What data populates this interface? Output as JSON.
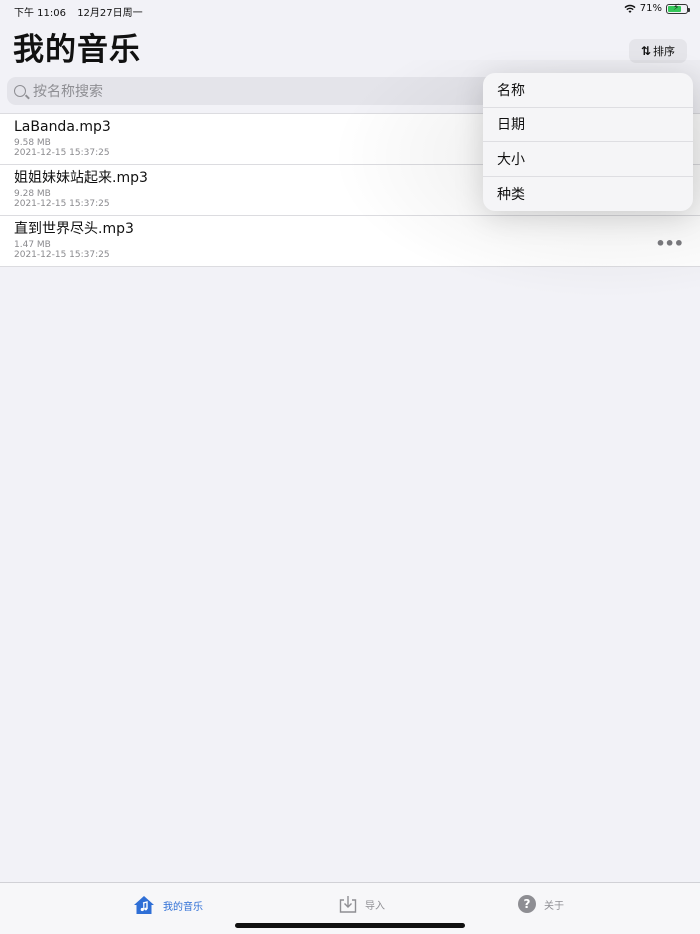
{
  "status_bar": {
    "time": "下午 11:06",
    "date": "12月27日周一",
    "battery": "71%",
    "battery_level": 0.71
  },
  "header": {
    "title": "我的音乐",
    "sort_label": "排序",
    "sort_icon": "sort-arrows-icon"
  },
  "search": {
    "placeholder": "按名称搜索"
  },
  "files": [
    {
      "name": "LaBanda.mp3",
      "size": "9.58 MB",
      "date": "2021-12-15 15:37:25"
    },
    {
      "name": "姐姐妹妹站起来.mp3",
      "size": "9.28 MB",
      "date": "2021-12-15 15:37:25"
    },
    {
      "name": "直到世界尽头.mp3",
      "size": "1.47 MB",
      "date": "2021-12-15 15:37:25"
    }
  ],
  "sort_menu": {
    "items": [
      {
        "label": "名称"
      },
      {
        "label": "日期"
      },
      {
        "label": "大小"
      },
      {
        "label": "种类"
      }
    ]
  },
  "tab_bar": {
    "tabs": [
      {
        "label": "我的音乐",
        "icon": "home-music-icon",
        "active": true
      },
      {
        "label": "导入",
        "icon": "import-icon",
        "active": false
      },
      {
        "label": "关于",
        "icon": "help-icon",
        "active": false
      }
    ]
  },
  "colors": {
    "accent": "#2f6fd6",
    "background": "#f2f2f7",
    "battery": "#34c759"
  }
}
